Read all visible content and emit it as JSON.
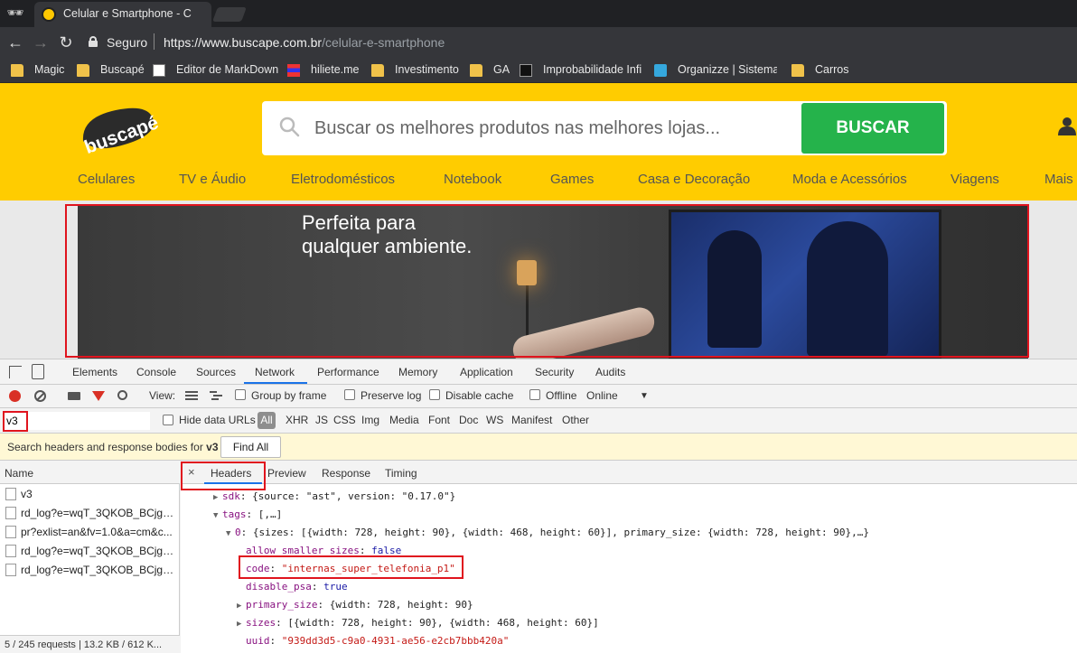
{
  "browser": {
    "incognito_icon": "incognito-icon",
    "tab_title": "Celular e Smartphone - C",
    "secure_label": "Seguro",
    "url_host": "https://www.buscape.com.br",
    "url_path": "/celular-e-smartphone"
  },
  "bookmarks": [
    {
      "label": "Magic",
      "icon": "folder-icon"
    },
    {
      "label": "Buscapé",
      "icon": "folder-icon"
    },
    {
      "label": "Editor de MarkDown",
      "icon": "markdown-icon"
    },
    {
      "label": "hiliete.me",
      "icon": "hiliete-icon"
    },
    {
      "label": "Investimento",
      "icon": "folder-icon"
    },
    {
      "label": "GA",
      "icon": "folder-icon"
    },
    {
      "label": "Improbabilidade Infi",
      "icon": "improbabilidade-icon"
    },
    {
      "label": "Organizze | Sistema",
      "icon": "organizze-icon"
    },
    {
      "label": "Carros",
      "icon": "folder-icon"
    }
  ],
  "site": {
    "logo_text": "buscapé",
    "search_placeholder": "Buscar os melhores produtos nas melhores lojas...",
    "search_button": "BUSCAR",
    "categories": [
      "Celulares",
      "TV e Áudio",
      "Eletrodomésticos",
      "Notebook",
      "Games",
      "Casa e Decoração",
      "Moda e Acessórios",
      "Viagens",
      "Mais C"
    ],
    "banner_line1": "Perfeita para",
    "banner_line2": "qualquer ambiente."
  },
  "devtools": {
    "tabs": [
      "Elements",
      "Console",
      "Sources",
      "Network",
      "Performance",
      "Memory",
      "Application",
      "Security",
      "Audits"
    ],
    "active_tab": "Network",
    "toolbar": {
      "view_label": "View:",
      "group_by_frame": "Group by frame",
      "preserve_log": "Preserve log",
      "disable_cache": "Disable cache",
      "offline": "Offline",
      "throttle": "Online"
    },
    "filter": {
      "value": "v3",
      "hide_data_urls": "Hide data URLs",
      "types": [
        "All",
        "XHR",
        "JS",
        "CSS",
        "Img",
        "Media",
        "Font",
        "Doc",
        "WS",
        "Manifest",
        "Other"
      ]
    },
    "search": {
      "hint_prefix": "Search headers and response bodies for",
      "hint_term": "v3",
      "find_all": "Find All"
    },
    "requests": {
      "header": "Name",
      "rows": [
        "v3",
        "rd_log?e=wqT_3QKOB_BCjgM...",
        "pr?exlist=an&fv=1.0&a=cm&c...",
        "rd_log?e=wqT_3QKOB_BCjgM...",
        "rd_log?e=wqT_3QKOB_BCjgM..."
      ],
      "status": "5 / 245 requests  |  13.2 KB / 612 K..."
    },
    "detail": {
      "close": "×",
      "tabs": [
        "Headers",
        "Preview",
        "Response",
        "Timing"
      ],
      "lines": [
        {
          "tri": "▶",
          "key": "sdk",
          "rest": ": {source: \"ast\", version: \"0.17.0\"}"
        },
        {
          "tri": "▼",
          "key": "tags",
          "rest": ": [,…]"
        },
        {
          "tri": "▼",
          "key": "0",
          "rest": ": {sizes: [{width: 728, height: 90}, {width: 468, height: 60}], primary_size: {width: 728, height: 90},…}"
        },
        {
          "tri": "",
          "key": "allow_smaller_sizes",
          "rest": ": ",
          "val": "false",
          "valtype": "b"
        },
        {
          "tri": "",
          "key": "code",
          "rest": ": ",
          "val": "\"internas_super_telefonia_p1\"",
          "valtype": "s"
        },
        {
          "tri": "",
          "key": "disable_psa",
          "rest": ": ",
          "val": "true",
          "valtype": "b"
        },
        {
          "tri": "▶",
          "key": "primary_size",
          "rest": ": {width: 728, height: 90}"
        },
        {
          "tri": "▶",
          "key": "sizes",
          "rest": ": [{width: 728, height: 90}, {width: 468, height: 60}]"
        },
        {
          "tri": "",
          "key": "uuid",
          "rest": ": ",
          "val": "\"939dd3d5-c9a0-4931-ae56-e2cb7bbb420a\"",
          "valtype": "s"
        }
      ]
    }
  },
  "colors": {
    "brand_yellow": "#ffcc00",
    "search_green": "#25b34b",
    "highlight_red": "#e0141e",
    "devtools_active": "#1a73e8"
  }
}
